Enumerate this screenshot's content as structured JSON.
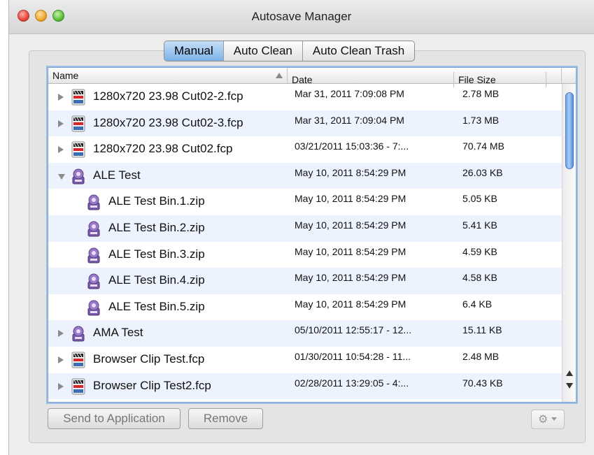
{
  "window": {
    "title": "Autosave Manager"
  },
  "tabs": [
    {
      "label": "Manual",
      "selected": true
    },
    {
      "label": "Auto Clean",
      "selected": false
    },
    {
      "label": "Auto Clean Trash",
      "selected": false
    }
  ],
  "table": {
    "columns": {
      "name": "Name",
      "date": "Date",
      "size": "File Size"
    },
    "sort": {
      "column": "Name",
      "direction": "ascending"
    },
    "rows": [
      {
        "name": "1280x720 23.98 Cut02-2.fcp",
        "date": "Mar 31, 2011 7:09:08 PM",
        "size": "2.78 MB",
        "icon": "fcp-project-icon",
        "disclosure": "closed",
        "indent": 0
      },
      {
        "name": "1280x720 23.98 Cut02-3.fcp",
        "date": "Mar 31, 2011 7:09:04 PM",
        "size": "1.73 MB",
        "icon": "fcp-project-icon",
        "disclosure": "closed",
        "indent": 0
      },
      {
        "name": "1280x720 23.98 Cut02.fcp",
        "date": "03/21/2011 15:03:36 - 7:...",
        "size": "70.74 MB",
        "icon": "fcp-project-icon",
        "disclosure": "closed",
        "indent": 0
      },
      {
        "name": "ALE Test",
        "date": "May 10, 2011 8:54:29 PM",
        "size": "26.03 KB",
        "icon": "bin-icon",
        "disclosure": "open",
        "indent": 0
      },
      {
        "name": "ALE Test Bin.1.zip",
        "date": "May 10, 2011 8:54:29 PM",
        "size": "5.05 KB",
        "icon": "bin-icon",
        "disclosure": "none",
        "indent": 1
      },
      {
        "name": "ALE Test Bin.2.zip",
        "date": "May 10, 2011 8:54:29 PM",
        "size": "5.41 KB",
        "icon": "bin-icon",
        "disclosure": "none",
        "indent": 1
      },
      {
        "name": "ALE Test Bin.3.zip",
        "date": "May 10, 2011 8:54:29 PM",
        "size": "4.59 KB",
        "icon": "bin-icon",
        "disclosure": "none",
        "indent": 1
      },
      {
        "name": "ALE Test Bin.4.zip",
        "date": "May 10, 2011 8:54:29 PM",
        "size": "4.58 KB",
        "icon": "bin-icon",
        "disclosure": "none",
        "indent": 1
      },
      {
        "name": "ALE Test Bin.5.zip",
        "date": "May 10, 2011 8:54:29 PM",
        "size": "6.4 KB",
        "icon": "bin-icon",
        "disclosure": "none",
        "indent": 1
      },
      {
        "name": "AMA Test",
        "date": "05/10/2011 12:55:17 - 12...",
        "size": "15.11 KB",
        "icon": "bin-icon",
        "disclosure": "closed",
        "indent": 0
      },
      {
        "name": "Browser Clip Test.fcp",
        "date": "01/30/2011 10:54:28 - 11...",
        "size": "2.48 MB",
        "icon": "fcp-project-icon",
        "disclosure": "closed",
        "indent": 0
      },
      {
        "name": "Browser Clip Test2.fcp",
        "date": "02/28/2011 13:29:05 - 4:...",
        "size": "70.43 KB",
        "icon": "fcp-project-icon",
        "disclosure": "closed",
        "indent": 0
      }
    ]
  },
  "buttons": {
    "send": "Send to Application",
    "remove": "Remove",
    "action": "gear-icon"
  },
  "colors": {
    "selected_tab": "#7db1e6",
    "row_alt": "#edf3fe",
    "focus_ring": "#9cc0ea",
    "scroll_thumb": "#6ea4e6"
  }
}
